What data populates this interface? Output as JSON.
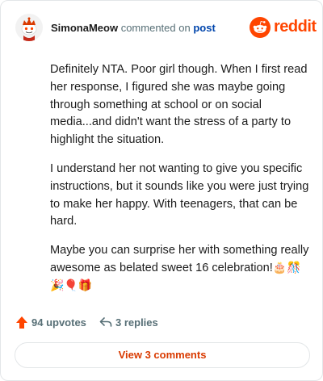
{
  "comment": {
    "author": "SimonaMeow",
    "action_text": "commented on",
    "target_link": "post",
    "brand": "reddit",
    "paragraphs": [
      "Definitely NTA. Poor girl though. When I first read her response, I figured she was maybe going through something at school or on social media...and didn't want the stress of a party to highlight the situation.",
      "I understand her not wanting to give you specific instructions, but it sounds like you were just trying to make her happy. With teenagers, that can be hard.",
      "Maybe you can surprise her with something really awesome as belated sweet 16 celebration!"
    ],
    "emojis": "🎂🎊🎉🎈🎁"
  },
  "actions": {
    "upvotes": "94 upvotes",
    "replies": "3 replies"
  },
  "footer": {
    "view_comments": "View 3 comments"
  },
  "colors": {
    "brand": "#ff4500",
    "link": "#0045ac",
    "upvote": "#ff4500",
    "view_button_text": "#d93a00"
  },
  "icons": {
    "avatar": "snoo-avatar",
    "brand_logo": "reddit-logo-icon",
    "upvote": "upvote-arrow-icon",
    "reply": "reply-arrow-icon"
  }
}
